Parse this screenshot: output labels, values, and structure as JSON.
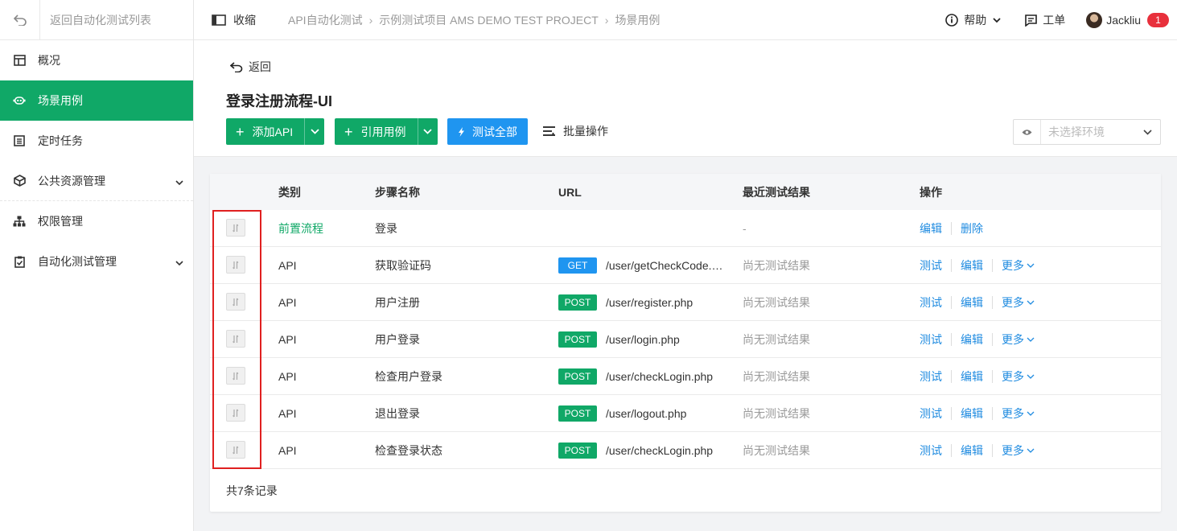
{
  "sidebar": {
    "back_label": "返回自动化测试列表",
    "items": [
      {
        "label": "概况",
        "icon": "dashboard-icon",
        "active": false,
        "expandable": false
      },
      {
        "label": "场景用例",
        "icon": "robot-icon",
        "active": true,
        "expandable": false
      },
      {
        "label": "定时任务",
        "icon": "list-icon",
        "active": false,
        "expandable": false
      },
      {
        "label": "公共资源管理",
        "icon": "cube-icon",
        "active": false,
        "expandable": true
      },
      {
        "label": "权限管理",
        "icon": "org-chart-icon",
        "active": false,
        "expandable": false
      },
      {
        "label": "自动化测试管理",
        "icon": "clipboard-check-icon",
        "active": false,
        "expandable": true
      }
    ]
  },
  "header": {
    "collapse_label": "收缩",
    "breadcrumbs": [
      "API自动化测试",
      "示例测试项目 AMS DEMO TEST PROJECT",
      "场景用例"
    ],
    "help_label": "帮助",
    "ticket_label": "工单",
    "username": "Jackliu",
    "notification_count": "1"
  },
  "page": {
    "return_label": "返回",
    "title": "登录注册流程-UI",
    "add_api_label": "添加API",
    "ref_case_label": "引用用例",
    "test_all_label": "测试全部",
    "batch_label": "批量操作",
    "env_placeholder": "未选择环境"
  },
  "table": {
    "columns": [
      "类别",
      "步骤名称",
      "URL",
      "最近测试结果",
      "操作"
    ],
    "rows": [
      {
        "category": "前置流程",
        "category_style": "green",
        "name": "登录",
        "method": "",
        "url": "",
        "result": "-",
        "actions": [
          "编辑",
          "删除"
        ]
      },
      {
        "category": "API",
        "category_style": "normal",
        "name": "获取验证码",
        "method": "GET",
        "url": "/user/getCheckCode.…",
        "result": "尚无测试结果",
        "actions": [
          "测试",
          "编辑",
          "更多"
        ]
      },
      {
        "category": "API",
        "category_style": "normal",
        "name": "用户注册",
        "method": "POST",
        "url": "/user/register.php",
        "result": "尚无测试结果",
        "actions": [
          "测试",
          "编辑",
          "更多"
        ]
      },
      {
        "category": "API",
        "category_style": "normal",
        "name": "用户登录",
        "method": "POST",
        "url": "/user/login.php",
        "result": "尚无测试结果",
        "actions": [
          "测试",
          "编辑",
          "更多"
        ]
      },
      {
        "category": "API",
        "category_style": "normal",
        "name": "检查用户登录",
        "method": "POST",
        "url": "/user/checkLogin.php",
        "result": "尚无测试结果",
        "actions": [
          "测试",
          "编辑",
          "更多"
        ]
      },
      {
        "category": "API",
        "category_style": "normal",
        "name": "退出登录",
        "method": "POST",
        "url": "/user/logout.php",
        "result": "尚无测试结果",
        "actions": [
          "测试",
          "编辑",
          "更多"
        ]
      },
      {
        "category": "API",
        "category_style": "normal",
        "name": "检查登录状态",
        "method": "POST",
        "url": "/user/checkLogin.php",
        "result": "尚无测试结果",
        "actions": [
          "测试",
          "编辑",
          "更多"
        ]
      }
    ],
    "footer": "共7条记录"
  },
  "colors": {
    "brand_green": "#10a867",
    "get_blue": "#1f95f0",
    "link_blue": "#1f8be0",
    "highlight_red": "#e02020"
  }
}
